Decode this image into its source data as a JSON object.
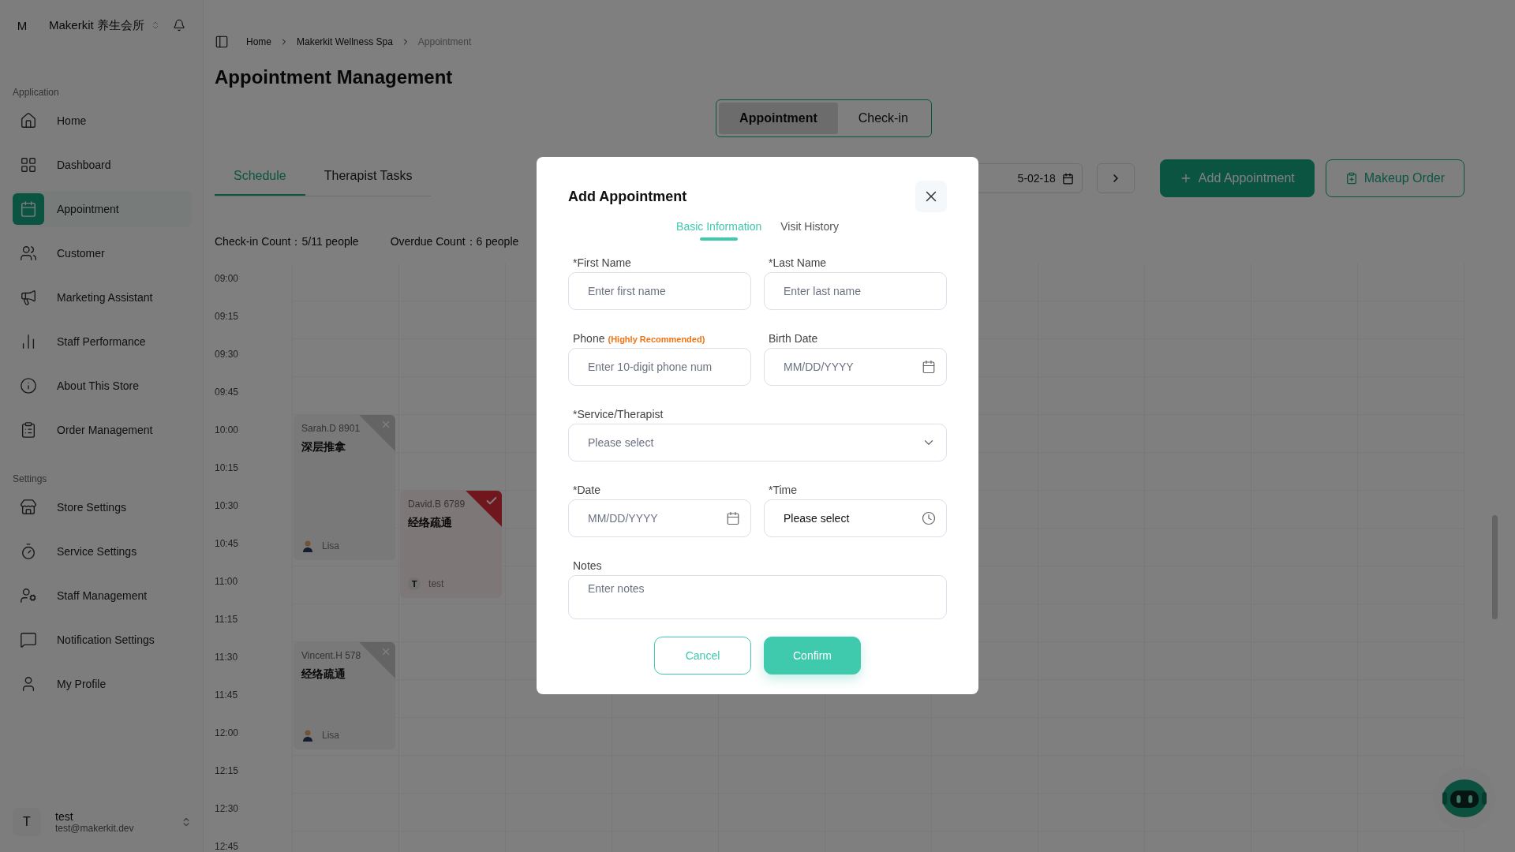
{
  "sidebar": {
    "org": {
      "avatar_letter": "M",
      "name": "Makerkit 养生会所"
    },
    "sections": [
      {
        "heading": "Application",
        "items": [
          {
            "label": "Home",
            "selected": false
          },
          {
            "label": "Dashboard",
            "selected": false
          },
          {
            "label": "Appointment",
            "selected": true
          },
          {
            "label": "Customer",
            "selected": false
          },
          {
            "label": "Marketing Assistant",
            "selected": false
          },
          {
            "label": "Staff Performance",
            "selected": false
          },
          {
            "label": "About This Store",
            "selected": false
          },
          {
            "label": "Order Management",
            "selected": false
          }
        ]
      },
      {
        "heading": "Settings",
        "items": [
          {
            "label": "Store Settings",
            "selected": false
          },
          {
            "label": "Service Settings",
            "selected": false
          },
          {
            "label": "Staff Management",
            "selected": false
          },
          {
            "label": "Notification Settings",
            "selected": false
          },
          {
            "label": "My Profile",
            "selected": false
          }
        ]
      }
    ],
    "user": {
      "avatar_letter": "T",
      "name": "test",
      "email": "test@makerkit.dev"
    }
  },
  "breadcrumb": [
    {
      "label": "Home",
      "current": false
    },
    {
      "label": "Makerkit Wellness Spa",
      "current": false
    },
    {
      "label": "Appointment",
      "current": true
    }
  ],
  "page_title": "Appointment Management",
  "view_toggle": [
    {
      "label": "Appointment",
      "selected": true
    },
    {
      "label": "Check-in",
      "selected": false
    }
  ],
  "tabs": [
    {
      "label": "Schedule",
      "selected": true
    },
    {
      "label": "Therapist Tasks",
      "selected": false
    }
  ],
  "date_field": {
    "value": "5-02-18"
  },
  "actions": [
    {
      "label": "Add Appointment",
      "kind": "primary"
    },
    {
      "label": "Makeup Order",
      "kind": "outline"
    }
  ],
  "counts": [
    "Check-in Count：5/11 people",
    "Overdue Count：6 people"
  ],
  "times": [
    "09:00",
    "09:15",
    "09:30",
    "09:45",
    "10:00",
    "10:15",
    "10:30",
    "10:45",
    "11:00",
    "11:15",
    "11:30",
    "11:45",
    "12:00",
    "12:15",
    "12:30",
    "12:45"
  ],
  "appointments": [
    {
      "customer": "Sarah.D 8901",
      "service": "深层推拿",
      "therapist": "Lisa",
      "kind": "cancelled",
      "avatar": {
        "kind": "photo"
      }
    },
    {
      "customer": "David.B 6789",
      "service": "经络疏通",
      "therapist": "test",
      "kind": "completed",
      "avatar": {
        "kind": "letter",
        "letter": "T"
      }
    },
    {
      "customer": "Vincent.H 578",
      "service": "经络疏通",
      "therapist": "Lisa",
      "kind": "cancelled",
      "avatar": {
        "kind": "photo"
      }
    }
  ],
  "modal": {
    "title": "Add Appointment",
    "tabs": [
      {
        "label": "Basic Information",
        "selected": true
      },
      {
        "label": "Visit History",
        "selected": false
      }
    ],
    "fields": [
      {
        "label": "*First Name",
        "kind": "text",
        "placeholder": "Enter first name"
      },
      {
        "label": "*Last Name",
        "kind": "text",
        "placeholder": "Enter last name"
      },
      {
        "label": "Phone",
        "hint": "(Highly Recommended)",
        "kind": "text",
        "placeholder": "Enter 10-digit phone num"
      },
      {
        "label": "Birth Date",
        "kind": "date",
        "placeholder": "MM/DD/YYYY"
      },
      {
        "label": "*Service/Therapist",
        "kind": "select",
        "placeholder": "Please select"
      },
      {
        "label": "*Date",
        "kind": "date",
        "placeholder": "MM/DD/YYYY"
      },
      {
        "label": "*Time",
        "kind": "time",
        "value": "Please select"
      },
      {
        "label": "Notes",
        "kind": "textarea",
        "placeholder": "Enter notes"
      }
    ],
    "buttons": [
      {
        "label": "Cancel",
        "kind": "outline"
      },
      {
        "label": "Confirm",
        "kind": "primary"
      }
    ]
  }
}
